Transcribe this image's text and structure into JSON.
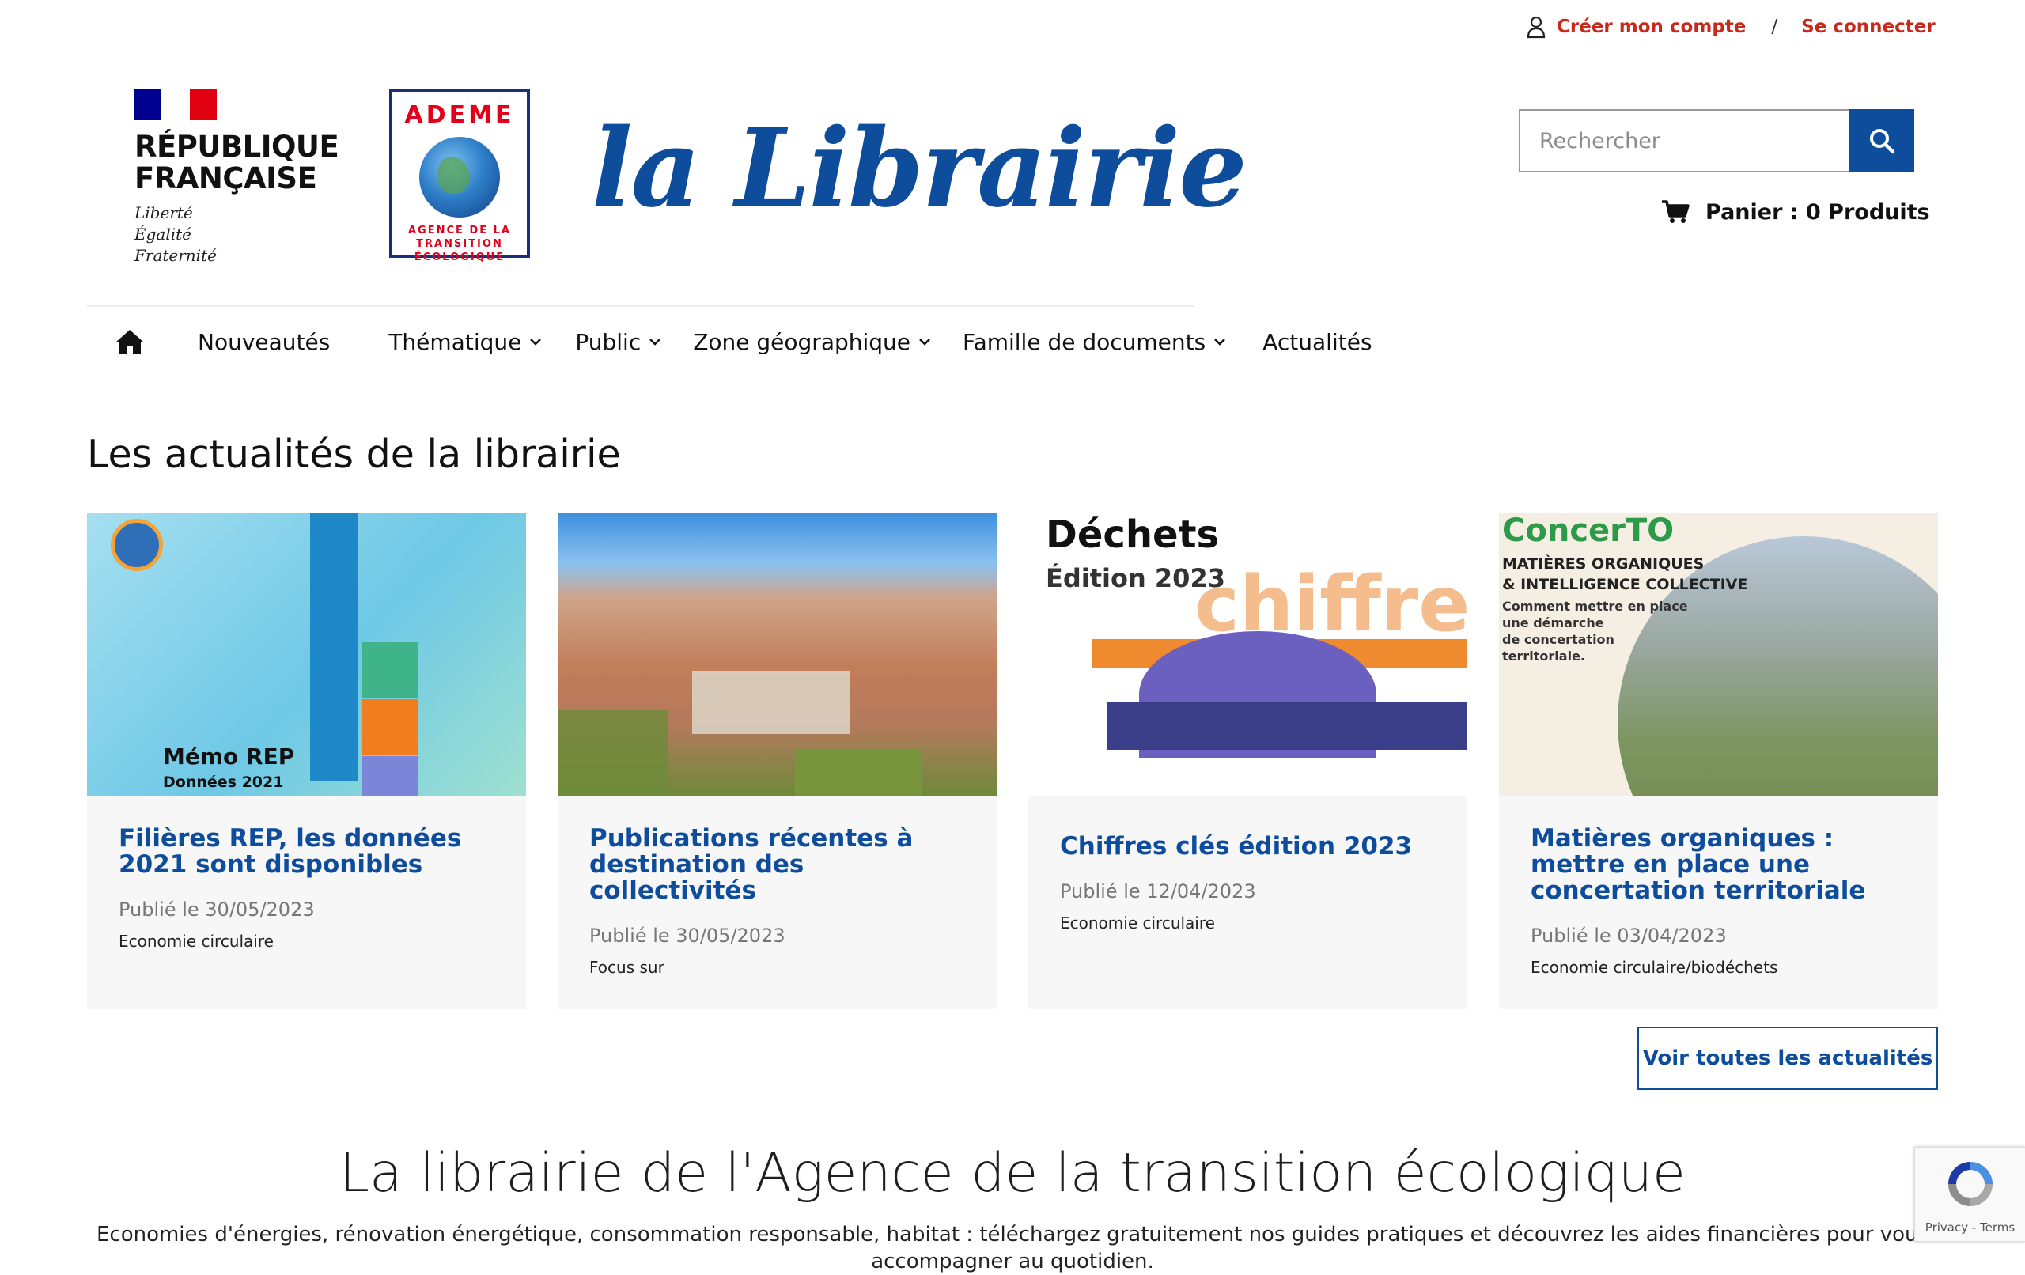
{
  "account": {
    "create": "Créer mon compte",
    "separator": "/",
    "login": "Se connecter"
  },
  "logos": {
    "republique_line1": "RÉPUBLIQUE",
    "republique_line2": "FRANÇAISE",
    "motto": [
      "Liberté",
      "Égalité",
      "Fraternité"
    ],
    "ademe_name": "ADEME",
    "ademe_sub": [
      "AGENCE DE LA",
      "TRANSITION",
      "ÉCOLOGIQUE"
    ],
    "brand": "la Librairie"
  },
  "search": {
    "placeholder": "Rechercher"
  },
  "cart": {
    "label": "Panier : 0 Produits"
  },
  "nav": {
    "items": [
      {
        "label": "Nouveautés"
      },
      {
        "label": "Thématique"
      },
      {
        "label": "Public"
      },
      {
        "label": "Zone géographique"
      },
      {
        "label": "Famille de documents"
      },
      {
        "label": "Actualités"
      }
    ]
  },
  "news": {
    "title": "Les actualités de la librairie",
    "cards": [
      {
        "title": "Filières REP, les données 2021 sont disponibles",
        "date": "Publié le 30/05/2023",
        "tag": "Economie circulaire",
        "img_text": [
          "Mémo REP",
          "Données 2021"
        ]
      },
      {
        "title": "Publications récentes à destination des collectivités",
        "date": "Publié le 30/05/2023",
        "tag": "Focus sur"
      },
      {
        "title": "Chiffres clés édition 2023",
        "date": "Publié le 12/04/2023",
        "tag": "Economie circulaire",
        "img_text": [
          "Déchets",
          "Édition 2023",
          "chiffre"
        ]
      },
      {
        "title": "Matières organiques : mettre en place une concertation territoriale",
        "date": "Publié le 03/04/2023",
        "tag": "Economie circulaire/biodéchets",
        "img_text": [
          "ConcerTO",
          "MATIÈRES ORGANIQUES",
          "& INTELLIGENCE COLLECTIVE",
          "Comment mettre en place",
          "une démarche",
          "de concertation",
          "territoriale."
        ]
      }
    ],
    "more": "Voir toutes les actualités"
  },
  "hero": {
    "title": "La librairie de l'Agence de la transition écologique",
    "text": "Economies d'énergies, rénovation énergétique, consommation responsable, habitat : téléchargez gratuitement nos guides pratiques et découvrez les aides financières pour vous accompagner au quotidien."
  },
  "recaptcha": {
    "text": "Privacy - Terms"
  },
  "colors": {
    "brand_blue": "#0e4c9c",
    "accent_red": "#c8291b"
  }
}
